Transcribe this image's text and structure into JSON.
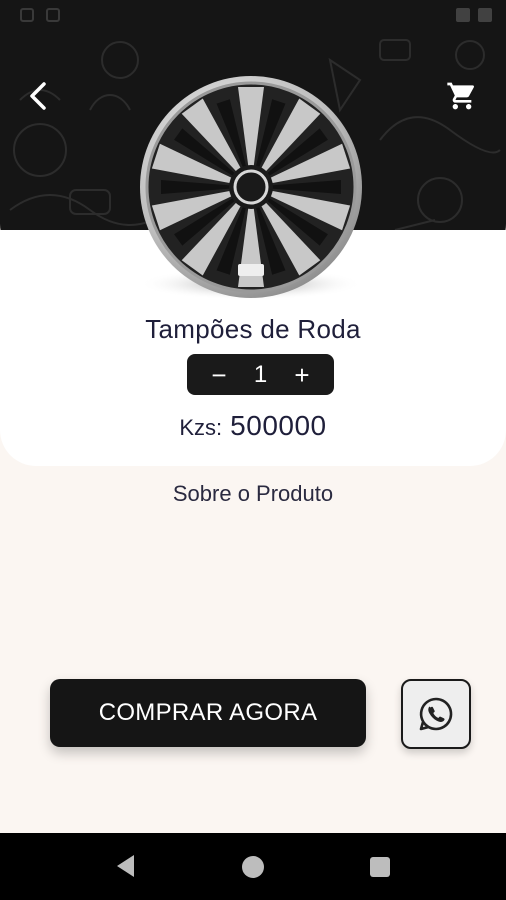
{
  "header": {
    "back_icon": "chevron-left-icon",
    "cart_icon": "shopping-cart-icon"
  },
  "product": {
    "image": "wheel-cover-image",
    "name": "Tampões de Roda",
    "quantity": "1",
    "decrement_label": "−",
    "increment_label": "+",
    "currency": "Kzs:",
    "price": "500000"
  },
  "about": {
    "label": "Sobre o Produto"
  },
  "actions": {
    "buy_label": "COMPRAR AGORA",
    "whatsapp_icon": "whatsapp-icon"
  },
  "colors": {
    "header_bg": "#151515",
    "page_bg": "#fbf6f2",
    "card_bg": "#ffffff",
    "button_bg": "#151515",
    "text": "#1f1f3a"
  }
}
